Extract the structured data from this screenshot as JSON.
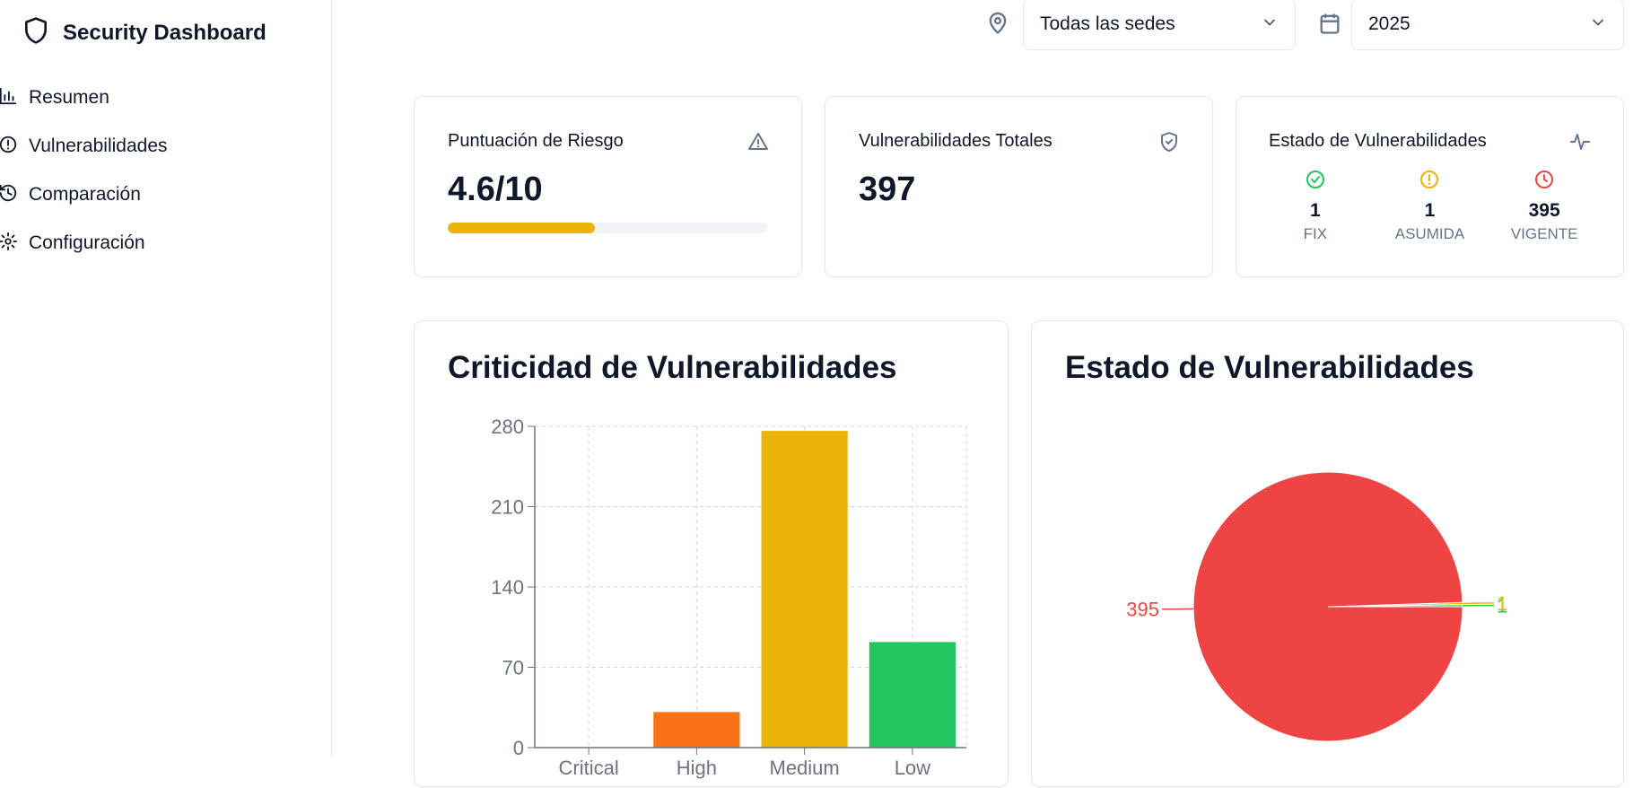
{
  "app": {
    "title": "Security Dashboard"
  },
  "sidebar": {
    "items": [
      {
        "label": "Resumen",
        "icon": "bar-chart-icon"
      },
      {
        "label": "Vulnerabilidades",
        "icon": "alert-circle-icon"
      },
      {
        "label": "Comparación",
        "icon": "history-icon"
      },
      {
        "label": "Configuración",
        "icon": "gear-icon"
      }
    ]
  },
  "filters": {
    "location": {
      "value": "Todas las sedes",
      "icon": "map-pin-icon"
    },
    "year": {
      "value": "2025",
      "icon": "calendar-icon"
    }
  },
  "cards": {
    "risk": {
      "title": "Puntuación de Riesgo",
      "value": "4.6/10",
      "progress": 0.46,
      "icon": "warning-triangle-icon",
      "bar_color": "#eab308"
    },
    "total": {
      "title": "Vulnerabilidades Totales",
      "value": "397",
      "icon": "shield-check-icon"
    },
    "status": {
      "title": "Estado de Vulnerabilidades",
      "icon": "activity-icon",
      "items": [
        {
          "count": "1",
          "label": "FIX",
          "icon": "check-circle-icon",
          "color": "#22c55e"
        },
        {
          "count": "1",
          "label": "ASUMIDA",
          "icon": "alert-circle-icon",
          "color": "#eab308"
        },
        {
          "count": "395",
          "label": "VIGENTE",
          "icon": "clock-icon",
          "color": "#ef4444"
        }
      ]
    }
  },
  "charts": {
    "criticality_title": "Criticidad de Vulnerabilidades",
    "status_title": "Estado de Vulnerabilidades"
  },
  "chart_data": [
    {
      "type": "bar",
      "title": "Criticidad de Vulnerabilidades",
      "categories": [
        "Critical",
        "High",
        "Medium",
        "Low"
      ],
      "values": [
        0,
        31,
        276,
        92
      ],
      "colors": [
        "#dc2626",
        "#f97316",
        "#eab308",
        "#22c55e"
      ],
      "yticks": [
        0,
        70,
        140,
        210,
        280
      ],
      "ylim": [
        0,
        280
      ],
      "grid": true
    },
    {
      "type": "pie",
      "title": "Estado de Vulnerabilidades",
      "labels": [
        "FIX",
        "ASUMIDA",
        "VIGENTE"
      ],
      "values": [
        1,
        1,
        395
      ],
      "colors": [
        "#22c55e",
        "#eab308",
        "#ef4444"
      ]
    }
  ]
}
